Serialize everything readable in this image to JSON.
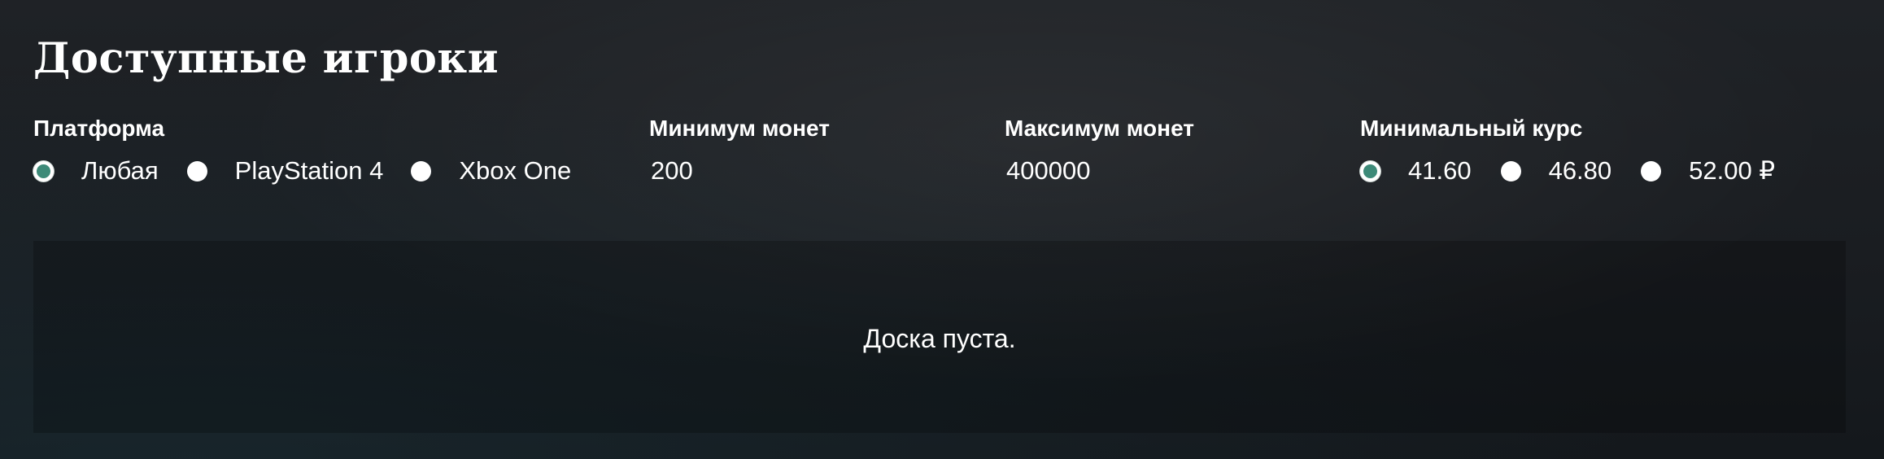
{
  "page": {
    "title": "Доступные игроки"
  },
  "filters": {
    "platform": {
      "label": "Платформа",
      "options": [
        "Любая",
        "PlayStation 4",
        "Xbox One"
      ],
      "selected": "Любая"
    },
    "min_coins": {
      "label": "Минимум монет",
      "value": "200"
    },
    "max_coins": {
      "label": "Максимум монет",
      "value": "400000"
    },
    "min_rate": {
      "label": "Минимальный курс",
      "options": [
        "41.60",
        "46.80",
        "52.00 ₽"
      ],
      "selected": "41.60"
    }
  },
  "board": {
    "empty_message": "Доска пуста."
  },
  "colors": {
    "radio_selected": "#3d8a78",
    "radio_unselected": "#ffffff",
    "text": "#ffffff"
  }
}
